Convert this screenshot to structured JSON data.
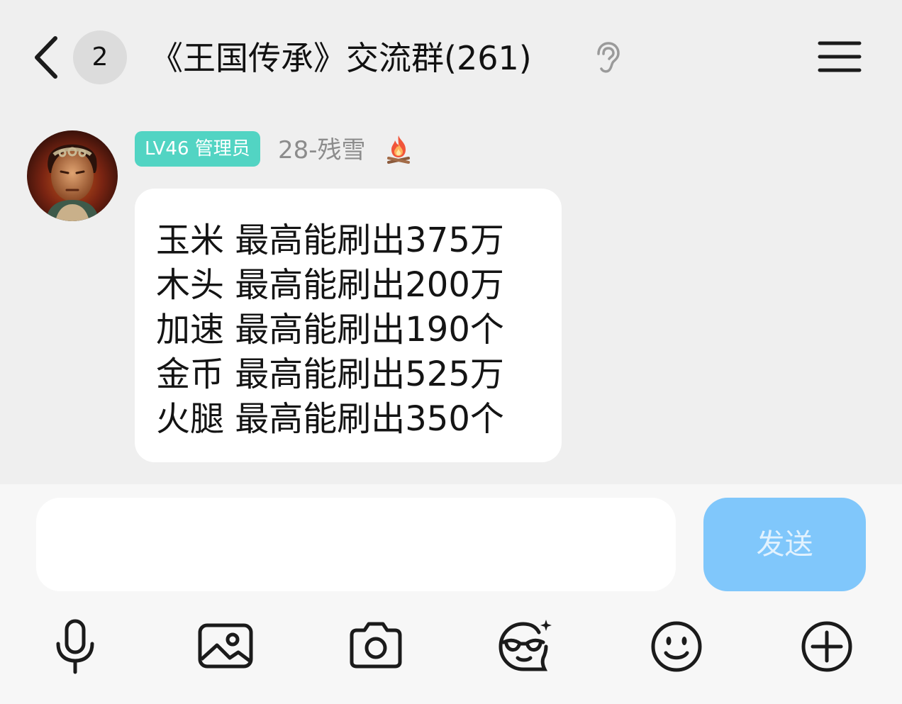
{
  "header": {
    "unread_count": "2",
    "title": "《王国传承》交流群(261)",
    "back_icon": "chevron-left-icon",
    "ear_icon": "ear-icon",
    "menu_icon": "hamburger-menu-icon"
  },
  "message": {
    "role_badge": "LV46 管理员",
    "sender": "28-残雪",
    "sender_icon": "fire-icon",
    "lines": [
      "玉米 最高能刷出375万",
      "木头 最高能刷出200万",
      "加速 最高能刷出190个",
      "金币 最高能刷出525万",
      "火腿 最高能刷出350个"
    ]
  },
  "input": {
    "value": "",
    "send_label": "发送"
  },
  "toolbar": [
    "microphone-icon",
    "image-icon",
    "camera-icon",
    "sticker-face-icon",
    "emoji-icon",
    "plus-circle-icon"
  ],
  "colors": {
    "page_bg": "#efefef",
    "bubble_bg": "#ffffff",
    "role_badge": "#52d4c3",
    "send_button": "#80c7fb",
    "input_area_bg": "#f7f7f7"
  }
}
